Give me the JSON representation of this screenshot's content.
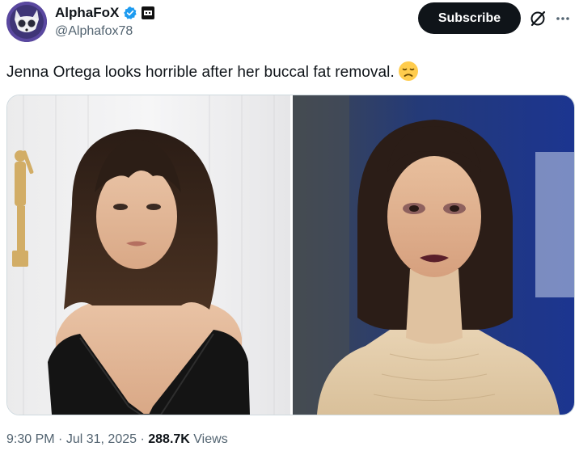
{
  "author": {
    "display_name": "AlphaFoX",
    "handle": "@Alphafox78"
  },
  "actions": {
    "subscribe_label": "Subscribe"
  },
  "tweet": {
    "text": "Jenna Ortega looks horrible after her buccal fat removal."
  },
  "meta": {
    "time": "9:30 PM",
    "date": "Jul 31, 2025",
    "views_count": "288.7K",
    "views_label": "Views"
  },
  "icons": {
    "verified": "verified-badge-icon",
    "affiliate": "affiliate-badge-icon",
    "grok": "grok-icon",
    "more": "more-icon",
    "emoji": "disappointed-face-emoji"
  },
  "colors": {
    "text": "#0f1419",
    "secondary": "#536471",
    "verified": "#1d9bf0",
    "subscribe_bg": "#0f1419",
    "border": "#cfd9de"
  }
}
